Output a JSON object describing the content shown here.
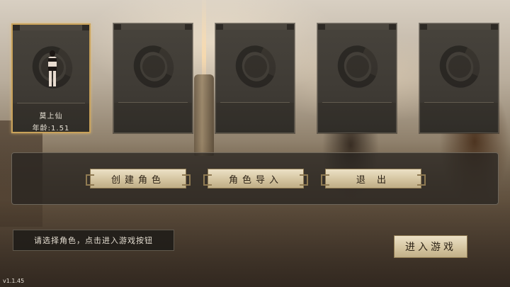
{
  "slots": [
    {
      "name": "莫上仙",
      "age": "年龄:1.51",
      "selected": true,
      "has_character": true
    },
    {
      "name": "",
      "age": "",
      "selected": false,
      "has_character": false
    },
    {
      "name": "",
      "age": "",
      "selected": false,
      "has_character": false
    },
    {
      "name": "",
      "age": "",
      "selected": false,
      "has_character": false
    },
    {
      "name": "",
      "age": "",
      "selected": false,
      "has_character": false
    }
  ],
  "actions": {
    "create_label": "创建角色",
    "import_label": "角色导入",
    "exit_label": "退 出"
  },
  "hint": "请选择角色，点击进入游戏按钮",
  "enter_label": "进入游戏",
  "version": "v1.1.45",
  "colors": {
    "accent_gold": "#c9a25a",
    "button_face": "#d4c4a0",
    "panel_dark": "#24211e",
    "text_light": "#e8e2d6"
  },
  "icons": {
    "slot_emblem": "ink-circle-icon"
  }
}
